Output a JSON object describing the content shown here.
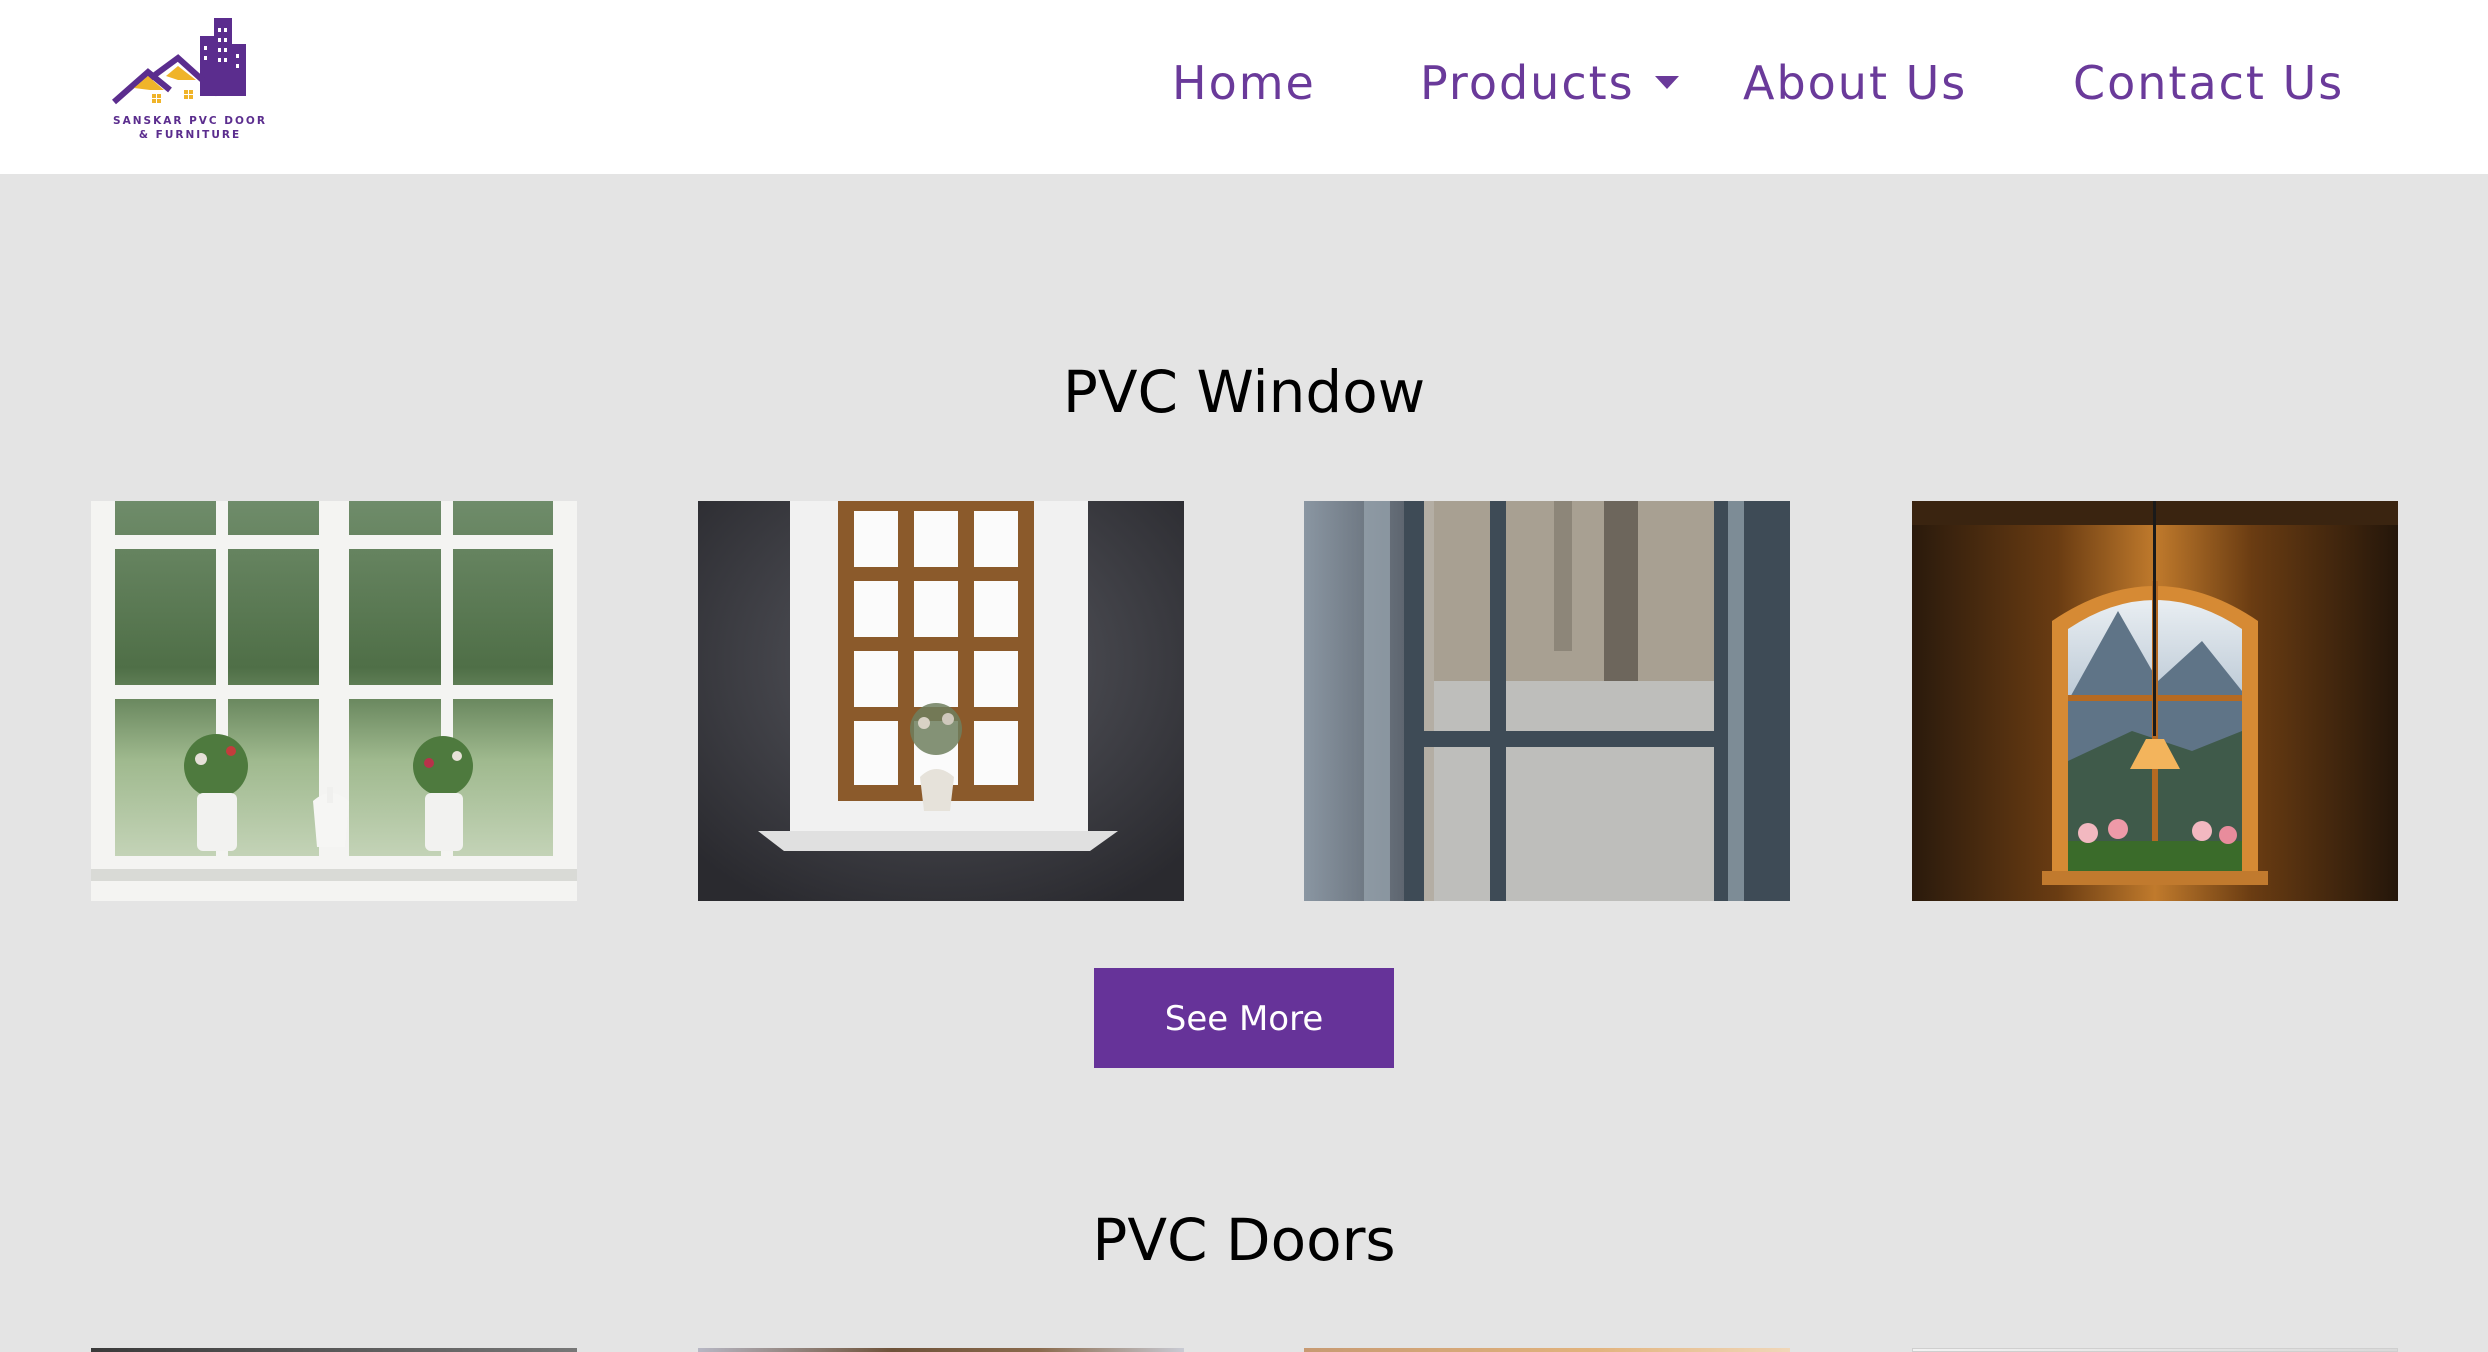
{
  "header": {
    "logo": {
      "line1": "SANSKAR PVC DOOR",
      "line2": "& FURNITURE"
    },
    "nav": {
      "home": "Home",
      "products": "Products",
      "about": "About Us",
      "contact": "Contact Us"
    }
  },
  "sections": {
    "windows": {
      "title": "PVC Window",
      "images": [
        "white-french-window-with-vases",
        "wooden-window-in-dark-wall",
        "frosted-window-with-curtain",
        "arched-window-with-lamp-and-mountains"
      ],
      "button_label": "See More"
    },
    "doors": {
      "title": "PVC Doors"
    }
  },
  "colors": {
    "brand_purple": "#663399",
    "nav_text": "#6a3a9a",
    "logo_gold": "#f0b429",
    "page_bg": "#e4e4e4"
  }
}
